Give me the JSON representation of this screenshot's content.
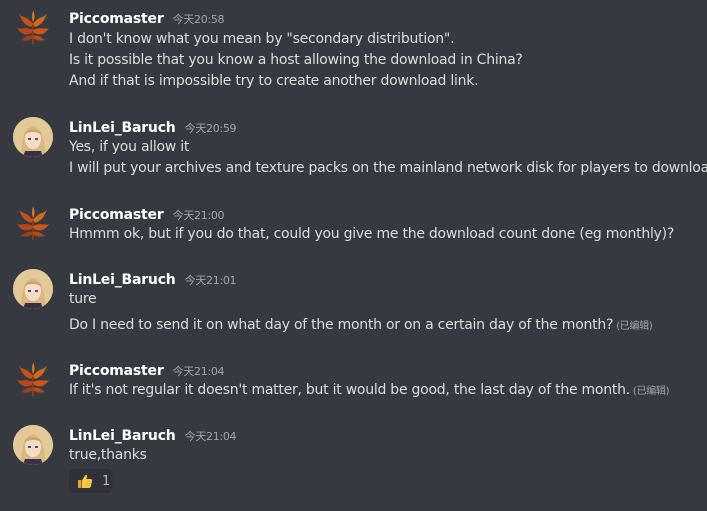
{
  "messages": [
    {
      "username": "Piccomaster",
      "timestamp": "今天20:58",
      "avatar": "maple-leaf-avatar",
      "lines": [
        "I don't know what you mean by \"secondary distribution\".",
        "Is it possible that you know a host allowing the download in China?",
        "And if that is impossible try to create another download link."
      ]
    },
    {
      "username": "LinLei_Baruch",
      "timestamp": "今天20:59",
      "avatar": "anime-girl-avatar",
      "lines": [
        "Yes, if you allow it",
        "I will put your archives and texture packs on the mainland network disk for players to download"
      ]
    },
    {
      "username": "Piccomaster",
      "timestamp": "今天21:00",
      "avatar": "maple-leaf-avatar",
      "lines": [
        "Hmmm ok, but if you do that, could you give me the download count done (eg monthly)?"
      ]
    },
    {
      "username": "LinLei_Baruch",
      "timestamp": "今天21:01",
      "avatar": "anime-girl-avatar",
      "lines": [
        "ture",
        "Do I need to send it on what day of the month or on a certain day of the month?"
      ],
      "edited_label": "(已编辑)"
    },
    {
      "username": "Piccomaster",
      "timestamp": "今天21:04",
      "avatar": "maple-leaf-avatar",
      "lines": [
        "If it's not regular it doesn't matter, but it would be good, the last day of the month."
      ],
      "edited_label": "(已编辑)"
    },
    {
      "username": "LinLei_Baruch",
      "timestamp": "今天21:04",
      "avatar": "anime-girl-avatar",
      "lines": [
        "true,thanks"
      ],
      "reaction": {
        "emoji": "thumbs-up-icon",
        "count": "1"
      }
    }
  ],
  "colors": {
    "background": "#36393f",
    "text": "#dcddde",
    "username": "#ffffff",
    "timestamp": "#a3a6aa",
    "reaction_bg": "#2f3136"
  }
}
